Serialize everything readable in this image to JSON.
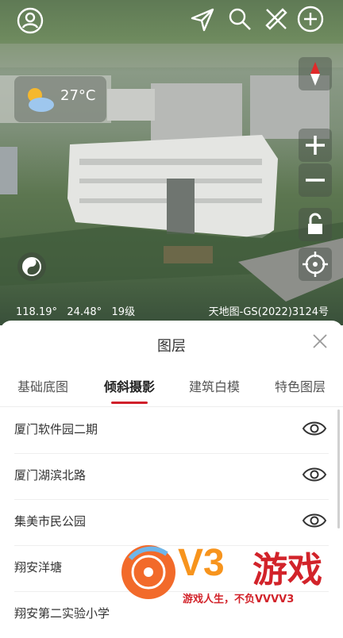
{
  "map": {
    "temperature": "27°C",
    "coords": {
      "longitude": "118.19°",
      "latitude": "24.48°",
      "zoom": "19级"
    },
    "copyright": "天地图-GS(2022)3124号",
    "icons": [
      "user-icon",
      "send-icon",
      "search-icon",
      "ruler-icon",
      "add-circle-icon",
      "compass-icon",
      "zoom-in-icon",
      "zoom-out-icon",
      "lock-icon",
      "locate-icon",
      "view-3d-icon",
      "weather-icon"
    ]
  },
  "panel": {
    "title": "图层",
    "tabs": [
      {
        "label": "基础底图"
      },
      {
        "label": "倾斜摄影",
        "active": true
      },
      {
        "label": "建筑白模"
      },
      {
        "label": "特色图层"
      }
    ],
    "layers": [
      {
        "name": "厦门软件园二期"
      },
      {
        "name": "厦门湖滨北路"
      },
      {
        "name": "集美市民公园"
      },
      {
        "name": "翔安洋塘"
      },
      {
        "name": "翔安第二实验小学"
      }
    ]
  },
  "watermark": {
    "brand": "V3",
    "name": "游戏",
    "slogan": "游戏人生，不负VVVV3"
  },
  "colors": {
    "accent": "#d0202a",
    "brand_orange": "#f7941d"
  }
}
